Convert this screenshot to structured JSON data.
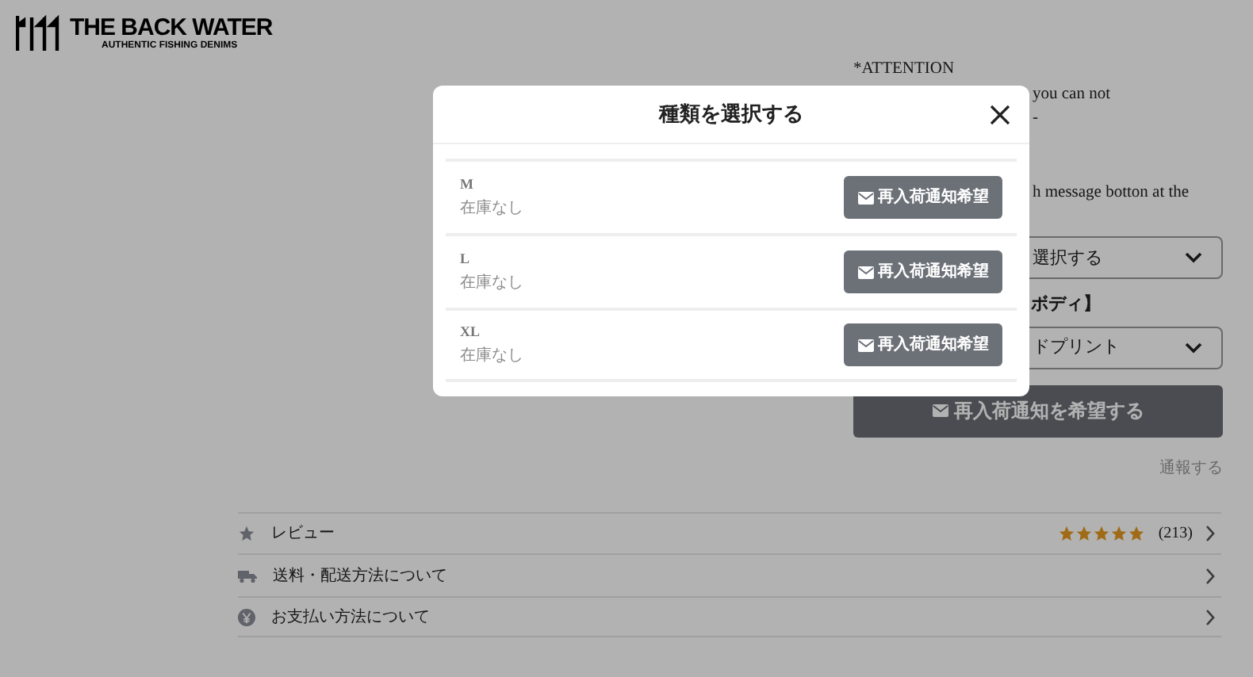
{
  "header": {
    "brand": "THE BACK WATER",
    "tagline": "AUTHENTIC FISHING DENIMS"
  },
  "product": {
    "notes": [
      "*ATTENTION",
      "you can not",
      "-",
      "h message botton at the"
    ],
    "selects": [
      {
        "value": "選択する"
      },
      {
        "label": "ボディ】",
        "value": "ドプリント"
      }
    ],
    "restock_button": "再入荷通知を希望する",
    "report_link": "通報する"
  },
  "info_rows": [
    {
      "kind": "review",
      "label": "レビュー",
      "stars": 5,
      "count": "(213)"
    },
    {
      "kind": "shipping",
      "label": "送料・配送方法について"
    },
    {
      "kind": "payment",
      "label": "お支払い方法について"
    }
  ],
  "modal": {
    "title": "種類を選択する",
    "variants": [
      {
        "size": "M",
        "stock": "在庫なし",
        "button": "再入荷通知希望"
      },
      {
        "size": "L",
        "stock": "在庫なし",
        "button": "再入荷通知希望"
      },
      {
        "size": "XL",
        "stock": "在庫なし",
        "button": "再入荷通知希望"
      }
    ]
  }
}
